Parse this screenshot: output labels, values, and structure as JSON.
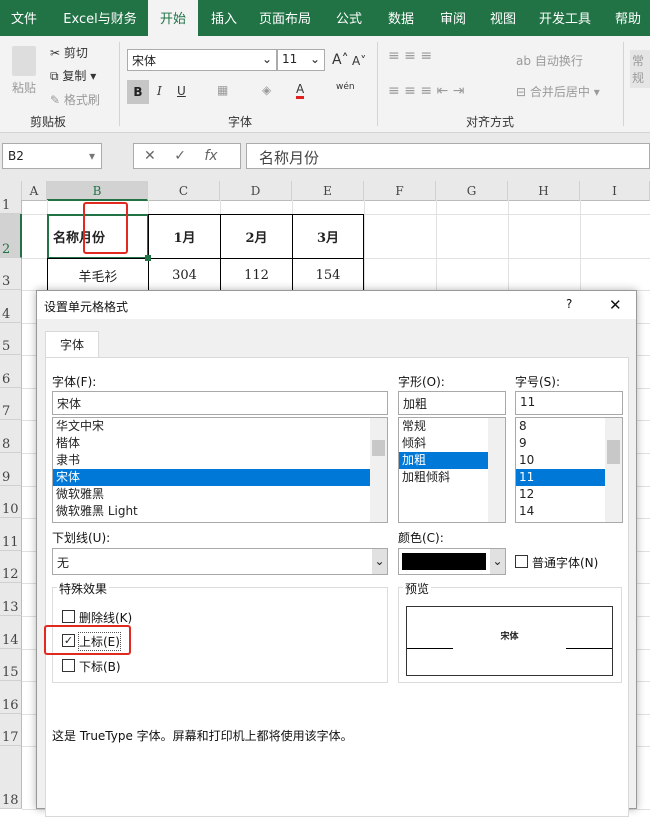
{
  "ribbon_tabs": [
    "文件",
    "Excel与财务",
    "开始",
    "插入",
    "页面布局",
    "公式",
    "数据",
    "审阅",
    "视图",
    "开发工具",
    "帮助"
  ],
  "selected_tab": "开始",
  "clipboard": {
    "paste": "粘贴",
    "cut": "剪切",
    "copy": "复制",
    "format_painter": "格式刷",
    "group": "剪贴板"
  },
  "font_group": {
    "font_name": "宋体",
    "font_size": "11",
    "bold": "B",
    "italic": "I",
    "underline": "U",
    "font_color_letter": "A",
    "phonetic": "wén",
    "group": "字体",
    "font_color": "#e02020"
  },
  "alignment": {
    "wrap_text": "自动换行",
    "merge_center": "合并后居中",
    "group": "对齐方式",
    "number_format": "常规"
  },
  "formula_bar": {
    "name_box": "B2",
    "formula": "名称月份",
    "fx": "fx"
  },
  "columns": [
    "A",
    "B",
    "C",
    "D",
    "E",
    "F",
    "G",
    "H",
    "I"
  ],
  "rows": [
    "1",
    "2",
    "3",
    "4",
    "5",
    "6",
    "7",
    "8",
    "9",
    "10",
    "11",
    "12",
    "13",
    "14",
    "15",
    "16",
    "17",
    "18"
  ],
  "table": {
    "header": [
      "名称月份",
      "1月",
      "2月",
      "3月"
    ],
    "row1": [
      "羊毛衫",
      "304",
      "112",
      "154"
    ]
  },
  "dialog": {
    "title": "设置单元格格式",
    "help": "?",
    "close": "✕",
    "tab": "字体",
    "font_label": "字体(F):",
    "font_value": "宋体",
    "font_list": [
      "华文中宋",
      "楷体",
      "隶书",
      "宋体",
      "微软雅黑",
      "微软雅黑 Light"
    ],
    "font_selected": "宋体",
    "style_label": "字形(O):",
    "style_value": "加粗",
    "style_list": [
      "常规",
      "倾斜",
      "加粗",
      "加粗倾斜"
    ],
    "style_selected": "加粗",
    "size_label": "字号(S):",
    "size_value": "11",
    "size_list": [
      "8",
      "9",
      "10",
      "11",
      "12",
      "14"
    ],
    "size_selected": "11",
    "underline_label": "下划线(U):",
    "underline_value": "无",
    "color_label": "颜色(C):",
    "color_value": "#000000",
    "normal_font": "普通字体(N)",
    "effects_label": "特殊效果",
    "strikethrough": "删除线(K)",
    "superscript": "上标(E)",
    "subscript": "下标(B)",
    "effects_checked": {
      "strikethrough": false,
      "superscript": true,
      "subscript": false
    },
    "preview_label": "预览",
    "preview_text": "宋体",
    "info": "这是 TrueType 字体。屏幕和打印机上都将使用该字体。"
  }
}
